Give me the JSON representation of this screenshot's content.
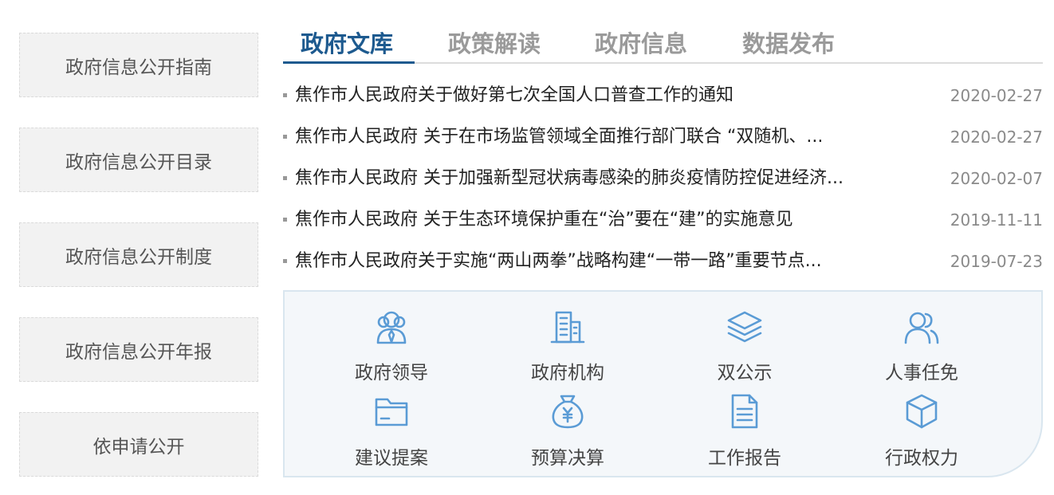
{
  "sidebar": {
    "items": [
      {
        "label": "政府信息公开指南"
      },
      {
        "label": "政府信息公开目录"
      },
      {
        "label": "政府信息公开制度"
      },
      {
        "label": "政府信息公开年报"
      },
      {
        "label": "依申请公开"
      }
    ]
  },
  "tabs": [
    {
      "label": "政府文库",
      "active": true
    },
    {
      "label": "政策解读",
      "active": false
    },
    {
      "label": "政府信息",
      "active": false
    },
    {
      "label": "数据发布",
      "active": false
    }
  ],
  "news": [
    {
      "title": "焦作市人民政府关于做好第七次全国人口普查工作的通知",
      "date": "2020-02-27"
    },
    {
      "title": "焦作市人民政府 关于在市场监管领域全面推行部门联合 “双随机、...",
      "date": "2020-02-27"
    },
    {
      "title": "焦作市人民政府 关于加强新型冠状病毒感染的肺炎疫情防控促进经济...",
      "date": "2020-02-07"
    },
    {
      "title": "焦作市人民政府 关于生态环境保护重在“治”要在“建”的实施意见",
      "date": "2019-11-11"
    },
    {
      "title": "焦作市人民政府关于实施“两山两拳”战略构建“一带一路”重要节点...",
      "date": "2019-07-23"
    }
  ],
  "services": [
    {
      "label": "政府领导",
      "icon": "leader-icon"
    },
    {
      "label": "政府机构",
      "icon": "building-icon"
    },
    {
      "label": "双公示",
      "icon": "layers-icon"
    },
    {
      "label": "人事任免",
      "icon": "users-icon"
    },
    {
      "label": "建议提案",
      "icon": "folder-icon"
    },
    {
      "label": "预算决算",
      "icon": "money-bag-icon"
    },
    {
      "label": "工作报告",
      "icon": "document-icon"
    },
    {
      "label": "行政权力",
      "icon": "cube-icon"
    }
  ],
  "colors": {
    "accent": "#1d5a8f",
    "icon": "#5a9bd5",
    "panel_bg": "#f4f7fa"
  }
}
